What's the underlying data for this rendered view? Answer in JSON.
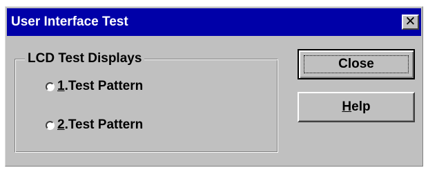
{
  "window": {
    "title": "User Interface Test",
    "close_glyph": "✕"
  },
  "group": {
    "legend": "LCD Test Displays",
    "options": [
      {
        "mnemonic": "1",
        "rest": ".Test Pattern",
        "selected": false
      },
      {
        "mnemonic": "2",
        "rest": ".Test Pattern",
        "selected": false
      }
    ]
  },
  "buttons": {
    "close_label": "Close",
    "help_mnemonic": "H",
    "help_rest": "elp"
  },
  "colors": {
    "titlebar": "#0000a8",
    "face": "#c0c0c0"
  },
  "icons": {
    "title_close": "close-icon"
  }
}
